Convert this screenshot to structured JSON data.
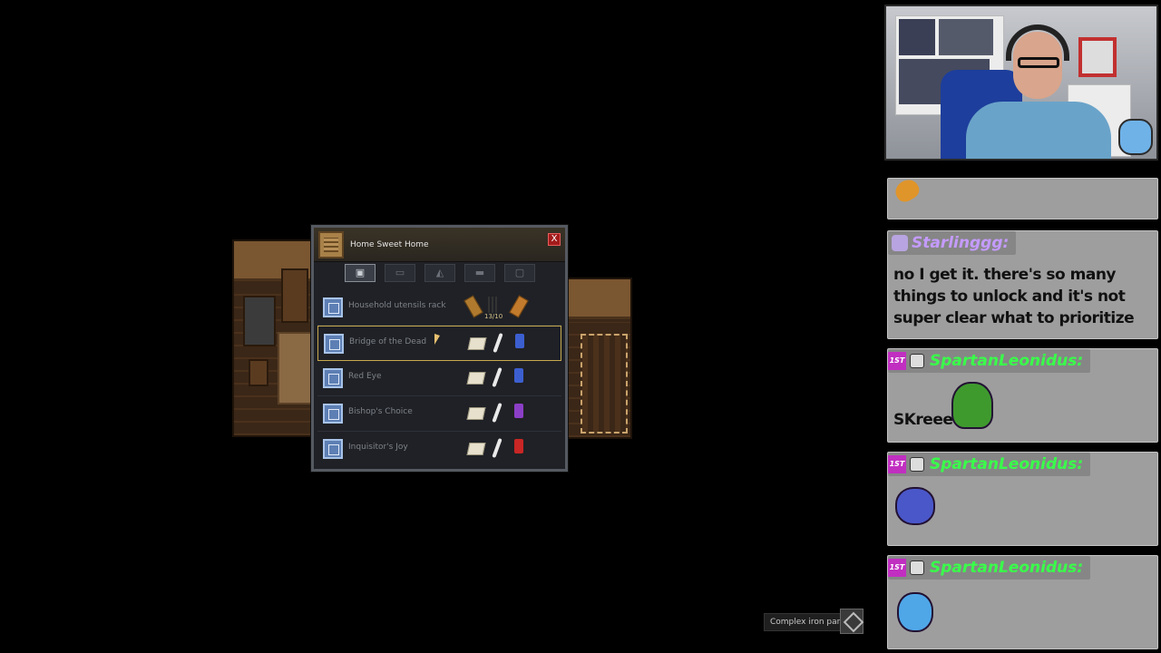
{
  "build_menu": {
    "title": "Home Sweet Home",
    "close_label": "X",
    "tabs": [
      "tab1",
      "tab2",
      "tab3",
      "tab4",
      "tab5"
    ],
    "items": [
      {
        "label": "Household utensils rack",
        "resources": [
          "wood",
          "nails",
          "plank"
        ],
        "count": "13/10"
      },
      {
        "label": "Bridge of the Dead",
        "resources": [
          "paper",
          "quill",
          "ink-blue"
        ],
        "selected": true
      },
      {
        "label": "Red Eye",
        "resources": [
          "paper",
          "quill",
          "ink-blue"
        ]
      },
      {
        "label": "Bishop's Choice",
        "resources": [
          "paper",
          "quill",
          "ink-purple"
        ]
      },
      {
        "label": "Inquisitor's Joy",
        "resources": [
          "paper",
          "quill",
          "ink-red"
        ]
      }
    ]
  },
  "chat": {
    "messages": [
      {
        "user": "",
        "text": "",
        "emote": "guitar-emote"
      },
      {
        "user": "Starlinggg:",
        "name_color": "#c59bff",
        "text": "no I get it. there's so many things to unlock and it's not super clear what to prioritize"
      },
      {
        "user": "SpartanLeonidus:",
        "name_color": "#39ff4a",
        "text": "SKreee",
        "emote": "bird-emote"
      },
      {
        "user": "SpartanLeonidus:",
        "name_color": "#39ff4a",
        "text": "",
        "emote": "blob-tongue-emote"
      },
      {
        "user": "SpartanLeonidus:",
        "name_color": "#39ff4a",
        "text": "",
        "emote": "blob-shout-emote"
      }
    ],
    "sub_badge_label": "1ST"
  },
  "tooltip": {
    "label": "Complex iron parts"
  },
  "colors": {
    "ink_blue": "#3c5fd0",
    "ink_purple": "#8b3fc7",
    "ink_red": "#c92626",
    "selection": "#c7a94e"
  }
}
